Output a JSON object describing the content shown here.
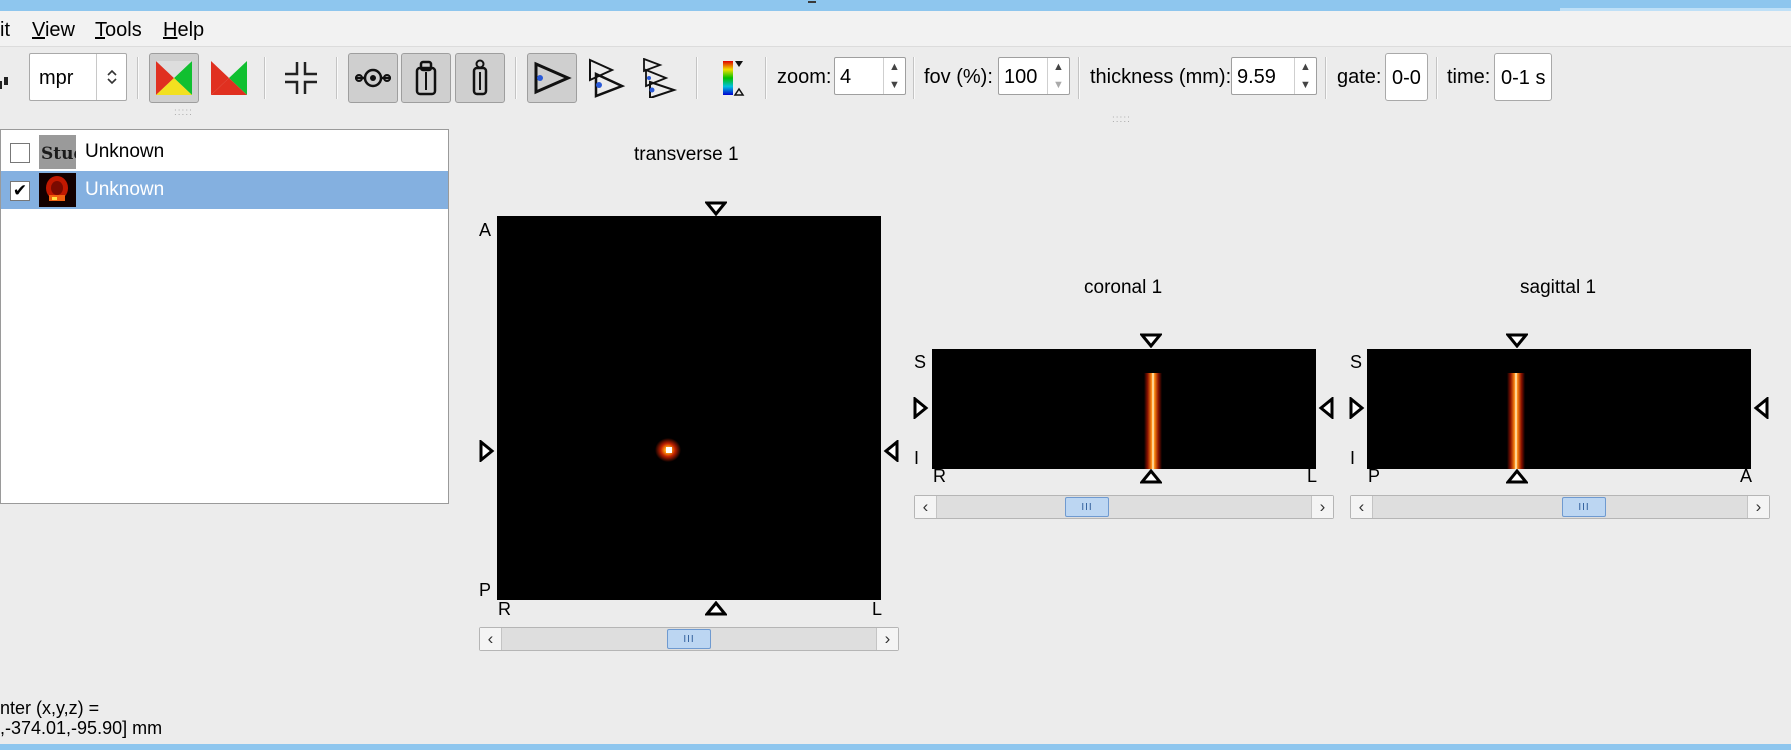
{
  "menubar": {
    "items": [
      {
        "label": "it",
        "accel": ""
      },
      {
        "label": "iew",
        "accel": "V"
      },
      {
        "label": "ools",
        "accel": "T"
      },
      {
        "label": "elp",
        "accel": "H"
      }
    ]
  },
  "toolbar": {
    "layout_select": "mpr",
    "zoom_label": "zoom:",
    "zoom_value": "4",
    "fov_label": "fov (%):",
    "fov_value": "100",
    "thickness_label": "thickness (mm):",
    "thickness_value": "9.59",
    "gate_label": "gate:",
    "gate_value": "0-0",
    "time_label": "time:",
    "time_value": "0-1 s"
  },
  "tree": {
    "rows": [
      {
        "label": "Unknown",
        "checked": false,
        "thumb_text": "Study"
      },
      {
        "label": "Unknown",
        "checked": true,
        "selected": true
      }
    ]
  },
  "views": {
    "transverse": {
      "title": "transverse 1",
      "top": "A",
      "bottom": "P",
      "left": "R",
      "right": "L"
    },
    "coronal": {
      "title": "coronal 1",
      "top": "S",
      "bottom": "I",
      "left": "R",
      "right": "L"
    },
    "sagittal": {
      "title": "sagittal 1",
      "top": "S",
      "bottom": "I",
      "left": "P",
      "right": "A"
    }
  },
  "status": {
    "line1": "nter (x,y,z) =",
    "line2": ",-374.01,-95.90] mm"
  },
  "colors": {
    "selection": "#84b0e0",
    "titlebar": "#8ec6ee"
  }
}
